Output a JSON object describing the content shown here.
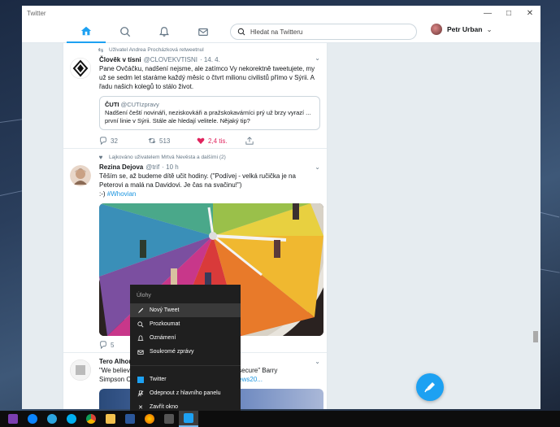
{
  "window": {
    "title": "Twitter",
    "controls": [
      "—",
      "□",
      "✕"
    ]
  },
  "nav": {
    "search_placeholder": "Hledat na Twitteru",
    "user_name": "Petr Urban"
  },
  "tweets": [
    {
      "context": "Uživatel Andrea Procházková retweetnul",
      "name": "Člověk v tísni",
      "handle": "@CLOVEKVTISNI",
      "time": "· 14. 4.",
      "text": "Pane Ovčáčku, nadšení nejsme, ale zatímco Vy nekorektně tweetujete, my už se sedm let staráme každý měsíc o čtvrt milionu civilistů přímo v Sýrii. A řadu našich kolegů to stálo život.",
      "quote": {
        "name": "ČUTI",
        "handle": "@CUTIzpravy",
        "text": "Nadšení čeští novináři, neziskovkáři a pražskokavárníci prý už brzy vyrazí ... první linie v Sýrii. Stále ale hledají velitele. Nějaký tip?"
      },
      "replies": "32",
      "retweets": "513",
      "likes": "2,4 tis."
    },
    {
      "context": "Lajkováno uživatelem Mrtvá Nevěsta a dalšími (2)",
      "name": "Rezina Dejova",
      "handle": "@trif",
      "time": "· 10 h",
      "text": "Těším se, až budeme dítě učit hodiny. (\"Podívej - velká ručička je na Peterovi a malá na Davidovi. Je čas na svačinu!\")",
      "text2": ":-) ",
      "hashtag": "#Whovian",
      "replies": "5"
    },
    {
      "name": "Tero Alhon",
      "text": "\"We believe",
      "text_tail": ", more secure\" Barry",
      "text2": "Simpson CIO",
      "link": "uritynews20..."
    }
  ],
  "jumplist": {
    "header": "Úlohy",
    "tasks": [
      "Nový Tweet",
      "Prozkoumat",
      "Oznámení",
      "Soukromé zprávy"
    ],
    "app_name": "Twitter",
    "pin_label": "Odepnout z hlavního panelu",
    "close_label": "Zavřít okno"
  },
  "colors": {
    "accent": "#1da1f2",
    "like": "#e0245e",
    "text": "#14171a",
    "muted": "#657786"
  }
}
